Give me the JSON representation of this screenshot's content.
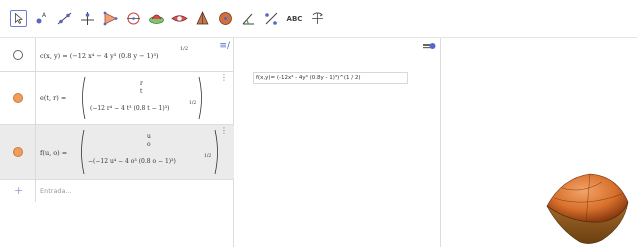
{
  "toolbar": {
    "tools": [
      "move-tool",
      "point-tool",
      "line-tool",
      "perpendicular-line-tool",
      "polygon-tool",
      "circle-tool",
      "intersect-surfaces-tool",
      "plane-tool",
      "pyramid-tool",
      "sphere-tool",
      "angle-tool",
      "reflect-tool",
      "text-tool",
      "rotate-view-tool"
    ],
    "text_tool_label": "ABC"
  },
  "algebra": {
    "rows": [
      {
        "name": "c(x, y)",
        "formula": "c(x, y) = (−12 x⁴ − 4 y³ (0.8 y − 1)³)",
        "exponent": "1/2",
        "marker": "hollow"
      },
      {
        "name": "e(t, r)",
        "lhs": "e(t, r) =",
        "entries": [
          "r",
          "t",
          "(−12 r⁴ − 4 t³ (0.8 t − 1)³)"
        ],
        "exponent": "1/2",
        "marker": "orange"
      },
      {
        "name": "f(u, o)",
        "lhs": "f(u, o) =",
        "entries": [
          "u",
          "o",
          "−(−12 u⁴ − 4 o³ (0.8 o − 1)³)"
        ],
        "exponent": "1/2",
        "marker": "orange"
      }
    ],
    "input_placeholder": "Entrada..."
  },
  "graphics2": {
    "function_label": "f(x,y)= (-12x⁴ - 4y³ (0.8y - 1)³)^(1 / 2)"
  },
  "colors": {
    "accent": "#5866c9",
    "surface_orange": "#e07b39",
    "point_orange": "#f09c5a",
    "selected_row": "#ebebeb"
  }
}
